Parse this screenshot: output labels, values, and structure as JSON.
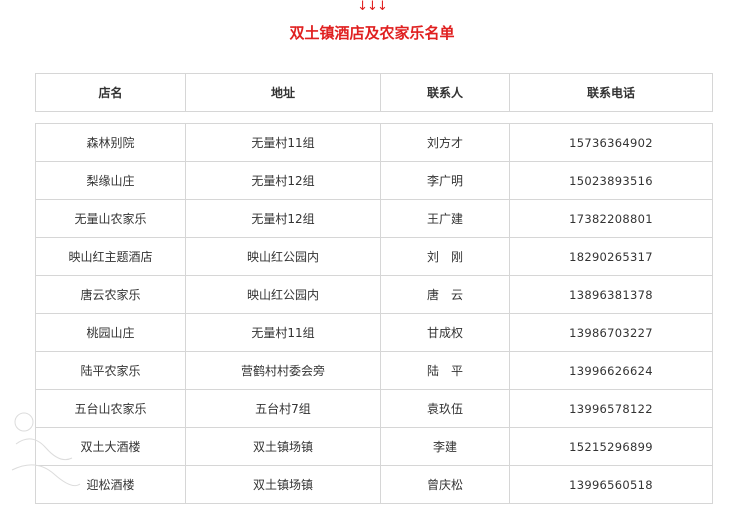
{
  "header": {
    "arrows": "↓↓↓",
    "title": "双土镇酒店及农家乐名单"
  },
  "table": {
    "columns": [
      "店名",
      "地址",
      "联系人",
      "联系电话"
    ],
    "rows": [
      [
        "森林别院",
        "无量村11组",
        "刘方才",
        "15736364902"
      ],
      [
        "梨缘山庄",
        "无量村12组",
        "李广明",
        "15023893516"
      ],
      [
        "无量山农家乐",
        "无量村12组",
        "王广建",
        "17382208801"
      ],
      [
        "映山红主题酒店",
        "映山红公园内",
        "刘　刚",
        "18290265317"
      ],
      [
        "唐云农家乐",
        "映山红公园内",
        "唐　云",
        "13896381378"
      ],
      [
        "桃园山庄",
        "无量村11组",
        "甘成权",
        "13986703227"
      ],
      [
        "陆平农家乐",
        "营鹤村村委会旁",
        "陆　平",
        "13996626624"
      ],
      [
        "五台山农家乐",
        "五台村7组",
        "袁玖伍",
        "13996578122"
      ],
      [
        "双土大酒楼",
        "双土镇场镇",
        "李建",
        "15215296899"
      ],
      [
        "迎松酒楼",
        "双土镇场镇",
        "曾庆松",
        "13996560518"
      ]
    ]
  },
  "colors": {
    "accent": "#e02020",
    "border": "#d6d6d6",
    "text": "#333333"
  }
}
